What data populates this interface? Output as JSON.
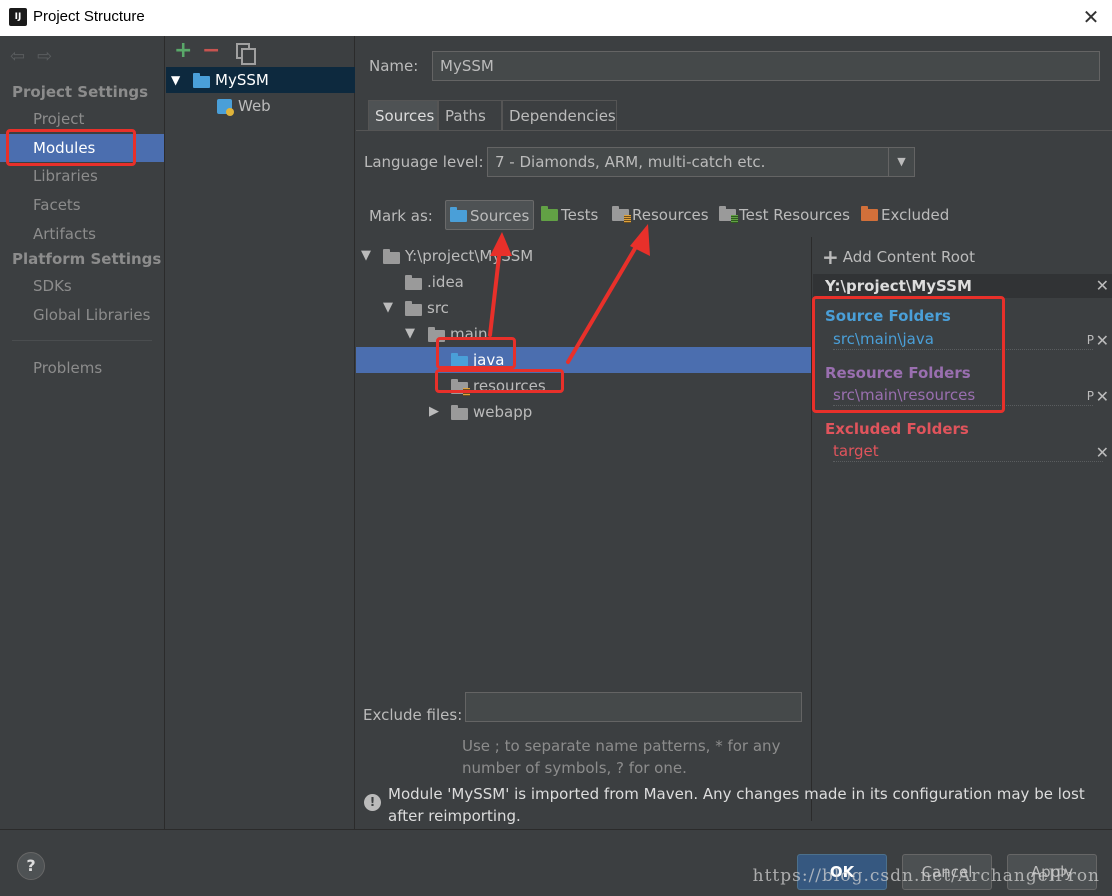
{
  "window": {
    "title": "Project Structure",
    "icon_text": "IJ"
  },
  "nav": {
    "heading_project": "Project Settings",
    "items_project": [
      "Project",
      "Modules",
      "Libraries",
      "Facets",
      "Artifacts"
    ],
    "heading_platform": "Platform Settings",
    "items_platform": [
      "SDKs",
      "Global Libraries"
    ],
    "problems": "Problems",
    "selected": "Modules"
  },
  "modules": {
    "toolbar": {
      "add": "+",
      "remove": "−"
    },
    "tree": [
      {
        "label": "MySSM",
        "expanded": true,
        "selected": true
      },
      {
        "label": "Web",
        "icon": "web-facet-icon"
      }
    ]
  },
  "main": {
    "name_label": "Name:",
    "name_value": "MySSM",
    "tabs": [
      "Sources",
      "Paths",
      "Dependencies"
    ],
    "active_tab": "Sources",
    "language_label": "Language level:",
    "language_value": "7 - Diamonds, ARM, multi-catch etc.",
    "mark_as_label": "Mark as:",
    "mark_buttons": [
      "Sources",
      "Tests",
      "Resources",
      "Test Resources",
      "Excluded"
    ],
    "file_tree": [
      {
        "label": "Y:\\project\\MySSM",
        "expanded": true
      },
      {
        "label": ".idea"
      },
      {
        "label": "src",
        "expanded": true
      },
      {
        "label": "main",
        "expanded": true
      },
      {
        "label": "java",
        "selected": true
      },
      {
        "label": "resources"
      },
      {
        "label": "webapp",
        "expanded": false
      }
    ],
    "content_root": {
      "add_label": "Add Content Root",
      "root_path": "Y:\\project\\MySSM",
      "source_title": "Source Folders",
      "source_path": "src\\main\\java",
      "resource_title": "Resource Folders",
      "resource_path": "src\\main\\resources",
      "excluded_title": "Excluded Folders",
      "excluded_path": "target",
      "edit_glyph": "P",
      "remove_glyph": "✕"
    },
    "exclude_files_label": "Exclude files:",
    "exclude_hint": "Use ; to separate name patterns, * for any number of symbols, ? for one.",
    "warning": "Module 'MySSM' is imported from Maven. Any changes made in its configuration may be lost after reimporting."
  },
  "buttons": {
    "ok": "OK",
    "cancel": "Cancel",
    "apply": "Apply",
    "help": "?"
  },
  "watermark": "https://blog.csdn.net/ArchangelPron",
  "colors": {
    "selection": "#4b6eaf",
    "source_folders": "#4a9fd8",
    "resource_folders": "#9a6fb0",
    "excluded_folders": "#e0545c",
    "annotation_red": "#e8302a"
  }
}
